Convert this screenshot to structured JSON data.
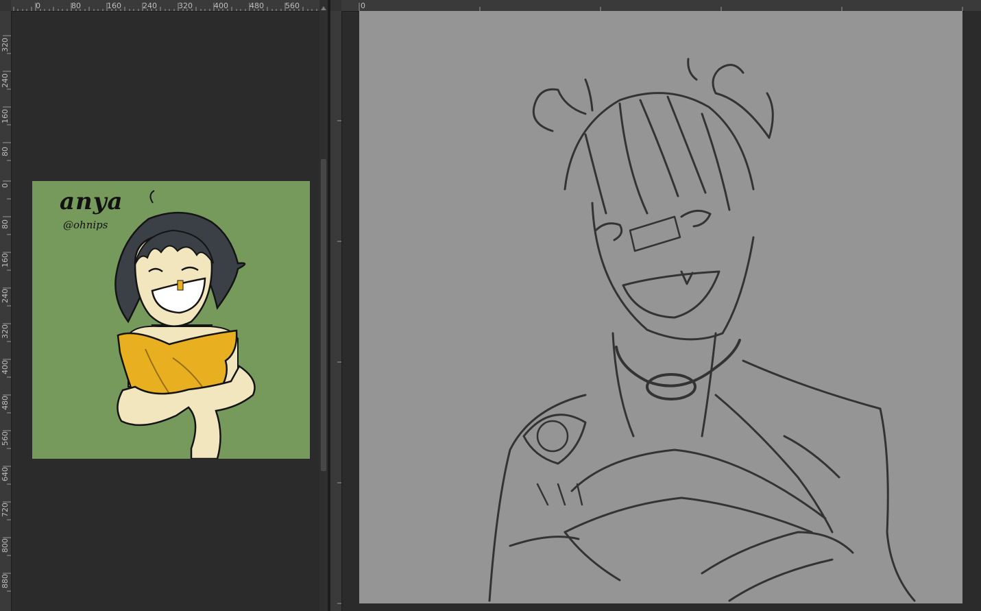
{
  "left_panel": {
    "ruler_top_labels": [
      "0",
      "80",
      "160",
      "240",
      "320",
      "400",
      "480",
      "560"
    ],
    "ruler_left_labels": [
      "320",
      "240",
      "160",
      "80",
      "0",
      "80",
      "160",
      "240",
      "320",
      "400",
      "480",
      "560",
      "640",
      "720",
      "800",
      "880"
    ],
    "reference_image": {
      "signature_name": "anya",
      "signature_handle": "@ohnips"
    }
  },
  "right_panel": {
    "ruler_top_labels": [
      "0"
    ]
  },
  "colors": {
    "workspace_bg": "#2b2b2b",
    "ruler_bg": "#3a3a3a",
    "reference_bg": "#76995c",
    "sketch_bg": "#959595",
    "shirt": "#e8b020",
    "skin": "#f2e6bf",
    "hair": "#3b3f46",
    "line": "#2a2a2a"
  }
}
